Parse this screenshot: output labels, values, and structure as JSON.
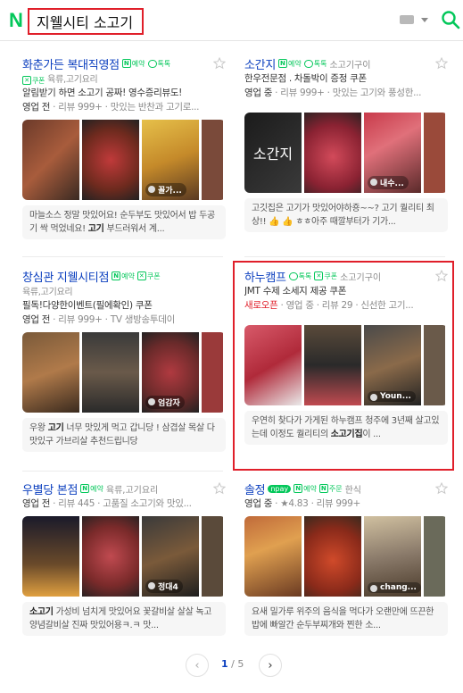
{
  "header": {
    "logo": "N",
    "search_query": "지웰시티 소고기"
  },
  "cards": [
    {
      "name": "화춘가든 복대직영점",
      "badges": [
        "예약",
        "톡톡"
      ],
      "coupon_label": "쿠폰",
      "category": "육류,고기요리",
      "line1": "알림받기 하면 소고기 공짜! 영수증리뷰도!",
      "line2_status": "영업 전",
      "line2_rest": " · 리뷰 999+ · 맛있는 반찬과 고기로...",
      "photo_label": "꼴가...",
      "review_pre": "마늘소스 정말 맛있어요! 순두부도 맛있어서 밥 두공기 싹 먹었네요! ",
      "review_bold": "고기",
      "review_post": " 부드러워서 계..."
    },
    {
      "name": "소간지",
      "badges": [
        "예약",
        "톡톡"
      ],
      "category": "소고기구이",
      "line1": "한우전문점 . 차돌박이 증정 쿠폰",
      "line2_status": "영업 중",
      "line2_rest": " · 리뷰 999+ · 맛있는 고기와 풍성한...",
      "photo_label": "내수...",
      "review_pre": "고깃집은 고기가 맛있어야하죵~~? 고기 퀄리티 최상!! 👍 👍 ㅎㅎ아주 때깔부터가 기가...",
      "review_bold": "",
      "review_post": ""
    },
    {
      "name": "창심관 지웰시티점",
      "badges": [
        "예약"
      ],
      "coupon_label": "쿠폰",
      "category": "육류,고기요리",
      "line1": "필독!다양한이벤트(필에확인) 쿠폰",
      "line2_status": "영업 전",
      "line2_rest": " · 리뷰 999+ · TV 생방송투데이",
      "photo_label": "엄감자",
      "review_pre": "우왕 ",
      "review_bold": "고기",
      "review_post": " 너무 맛있게 먹고 갑니당 ! 삼겹살 목살 다 맛있구 가브리살 추천드립니당"
    },
    {
      "name": "하누캠프",
      "badges": [
        "톡톡"
      ],
      "coupon_label": "쿠폰",
      "category": "소고기구이",
      "line1": "JMT 수제 소세지 제공 쿠폰",
      "line2_status": "새로오픈",
      "line2_rest": " · 영업 중 · 리뷰 29 · 신선한 고기...",
      "photo_label": "Youn...",
      "review_pre": "우연히 찾다가 가게된 하누캠프 청주에 3년째 살고있는데 이정도 퀄리티의 ",
      "review_bold": "소고기집",
      "review_post": "이 ..."
    },
    {
      "name": "우별당 본점",
      "badges": [
        "예약"
      ],
      "category": "육류,고기요리",
      "line1": "",
      "line2_status": "영업 전",
      "line2_rest": " · 리뷰 445 · 고품질 소고기와 맛있...",
      "photo_label": "정대4",
      "review_pre": "",
      "review_bold": "소고기",
      "review_post": " 가성비 넘치게 맛있어요 꽃갈비살 살살 녹고 양념갈비살 진짜 맛있어용ㅋ.ㅋ 맛..."
    },
    {
      "name": "솔정",
      "badges": [
        "npay",
        "예약",
        "주문"
      ],
      "category": "한식",
      "line1": "",
      "line2_status": "영업 중",
      "line2_rest": " · ★4.83 · 리뷰 999+",
      "photo_label": "chang...",
      "review_pre": "요새 밀가루 위주의 음식을 먹다가 오랜만에 뜨끈한 밥에 빠알간 순두부찌개와 찐한 소...",
      "review_bold": "",
      "review_post": ""
    }
  ],
  "pagination": {
    "current": "1",
    "separator": " / ",
    "total": "5"
  },
  "colors": {
    "naver_green": "#03c75a",
    "link_blue": "#0b3fbf",
    "highlight_red": "#e01f2a"
  }
}
